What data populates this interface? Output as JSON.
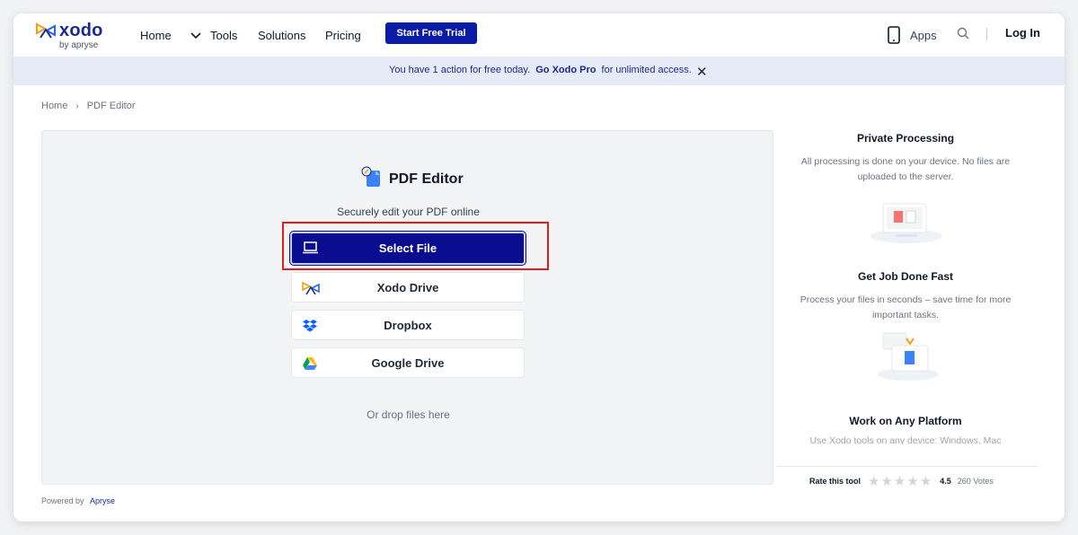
{
  "header": {
    "logo_word": "xodo",
    "logo_sub": "by apryse",
    "nav": [
      "Home",
      "Tools",
      "Solutions",
      "Pricing"
    ],
    "trial_button": "Start Free Trial",
    "apps_label": "Apps",
    "login_label": "Log In"
  },
  "banner": {
    "text_before": "You have 1 action for free today.",
    "link": "Go Xodo Pro",
    "text_after": "for unlimited access.",
    "close": "✕"
  },
  "breadcrumb": {
    "home": "Home",
    "separator": "›",
    "current": "PDF Editor"
  },
  "tool": {
    "title": "PDF Editor",
    "subtitle": "Securely edit your PDF online",
    "select_file": "Select File",
    "sources": [
      "Xodo Drive",
      "Dropbox",
      "Google Drive"
    ],
    "drop_text": "Or drop files here"
  },
  "footer": {
    "powered_by": "Powered by",
    "powered_brand": "Apryse"
  },
  "features": [
    {
      "title": "Private Processing",
      "description": "All processing is done on your device. No files are uploaded to the server."
    },
    {
      "title": "Get Job Done Fast",
      "description": "Process your files in seconds – save time for more important tasks."
    },
    {
      "title": "Work on Any Platform",
      "description": "Use Xodo tools on any device: Windows, Mac"
    }
  ],
  "rating": {
    "label": "Rate this tool",
    "stars": 5,
    "value": "4.5",
    "votes": "260 Votes"
  },
  "colors": {
    "brand": "#0a1ba8",
    "highlight": "#e11d1d",
    "banner_bg": "#e7eaf7"
  }
}
